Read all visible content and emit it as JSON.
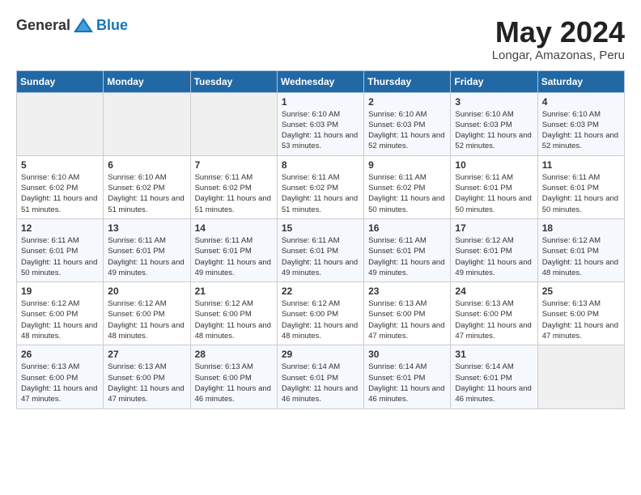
{
  "header": {
    "logo_general": "General",
    "logo_blue": "Blue",
    "month": "May 2024",
    "location": "Longar, Amazonas, Peru"
  },
  "weekdays": [
    "Sunday",
    "Monday",
    "Tuesday",
    "Wednesday",
    "Thursday",
    "Friday",
    "Saturday"
  ],
  "weeks": [
    [
      {
        "day": "",
        "sunrise": "",
        "sunset": "",
        "daylight": ""
      },
      {
        "day": "",
        "sunrise": "",
        "sunset": "",
        "daylight": ""
      },
      {
        "day": "",
        "sunrise": "",
        "sunset": "",
        "daylight": ""
      },
      {
        "day": "1",
        "sunrise": "Sunrise: 6:10 AM",
        "sunset": "Sunset: 6:03 PM",
        "daylight": "Daylight: 11 hours and 53 minutes."
      },
      {
        "day": "2",
        "sunrise": "Sunrise: 6:10 AM",
        "sunset": "Sunset: 6:03 PM",
        "daylight": "Daylight: 11 hours and 52 minutes."
      },
      {
        "day": "3",
        "sunrise": "Sunrise: 6:10 AM",
        "sunset": "Sunset: 6:03 PM",
        "daylight": "Daylight: 11 hours and 52 minutes."
      },
      {
        "day": "4",
        "sunrise": "Sunrise: 6:10 AM",
        "sunset": "Sunset: 6:03 PM",
        "daylight": "Daylight: 11 hours and 52 minutes."
      }
    ],
    [
      {
        "day": "5",
        "sunrise": "Sunrise: 6:10 AM",
        "sunset": "Sunset: 6:02 PM",
        "daylight": "Daylight: 11 hours and 51 minutes."
      },
      {
        "day": "6",
        "sunrise": "Sunrise: 6:10 AM",
        "sunset": "Sunset: 6:02 PM",
        "daylight": "Daylight: 11 hours and 51 minutes."
      },
      {
        "day": "7",
        "sunrise": "Sunrise: 6:11 AM",
        "sunset": "Sunset: 6:02 PM",
        "daylight": "Daylight: 11 hours and 51 minutes."
      },
      {
        "day": "8",
        "sunrise": "Sunrise: 6:11 AM",
        "sunset": "Sunset: 6:02 PM",
        "daylight": "Daylight: 11 hours and 51 minutes."
      },
      {
        "day": "9",
        "sunrise": "Sunrise: 6:11 AM",
        "sunset": "Sunset: 6:02 PM",
        "daylight": "Daylight: 11 hours and 50 minutes."
      },
      {
        "day": "10",
        "sunrise": "Sunrise: 6:11 AM",
        "sunset": "Sunset: 6:01 PM",
        "daylight": "Daylight: 11 hours and 50 minutes."
      },
      {
        "day": "11",
        "sunrise": "Sunrise: 6:11 AM",
        "sunset": "Sunset: 6:01 PM",
        "daylight": "Daylight: 11 hours and 50 minutes."
      }
    ],
    [
      {
        "day": "12",
        "sunrise": "Sunrise: 6:11 AM",
        "sunset": "Sunset: 6:01 PM",
        "daylight": "Daylight: 11 hours and 50 minutes."
      },
      {
        "day": "13",
        "sunrise": "Sunrise: 6:11 AM",
        "sunset": "Sunset: 6:01 PM",
        "daylight": "Daylight: 11 hours and 49 minutes."
      },
      {
        "day": "14",
        "sunrise": "Sunrise: 6:11 AM",
        "sunset": "Sunset: 6:01 PM",
        "daylight": "Daylight: 11 hours and 49 minutes."
      },
      {
        "day": "15",
        "sunrise": "Sunrise: 6:11 AM",
        "sunset": "Sunset: 6:01 PM",
        "daylight": "Daylight: 11 hours and 49 minutes."
      },
      {
        "day": "16",
        "sunrise": "Sunrise: 6:11 AM",
        "sunset": "Sunset: 6:01 PM",
        "daylight": "Daylight: 11 hours and 49 minutes."
      },
      {
        "day": "17",
        "sunrise": "Sunrise: 6:12 AM",
        "sunset": "Sunset: 6:01 PM",
        "daylight": "Daylight: 11 hours and 49 minutes."
      },
      {
        "day": "18",
        "sunrise": "Sunrise: 6:12 AM",
        "sunset": "Sunset: 6:01 PM",
        "daylight": "Daylight: 11 hours and 48 minutes."
      }
    ],
    [
      {
        "day": "19",
        "sunrise": "Sunrise: 6:12 AM",
        "sunset": "Sunset: 6:00 PM",
        "daylight": "Daylight: 11 hours and 48 minutes."
      },
      {
        "day": "20",
        "sunrise": "Sunrise: 6:12 AM",
        "sunset": "Sunset: 6:00 PM",
        "daylight": "Daylight: 11 hours and 48 minutes."
      },
      {
        "day": "21",
        "sunrise": "Sunrise: 6:12 AM",
        "sunset": "Sunset: 6:00 PM",
        "daylight": "Daylight: 11 hours and 48 minutes."
      },
      {
        "day": "22",
        "sunrise": "Sunrise: 6:12 AM",
        "sunset": "Sunset: 6:00 PM",
        "daylight": "Daylight: 11 hours and 48 minutes."
      },
      {
        "day": "23",
        "sunrise": "Sunrise: 6:13 AM",
        "sunset": "Sunset: 6:00 PM",
        "daylight": "Daylight: 11 hours and 47 minutes."
      },
      {
        "day": "24",
        "sunrise": "Sunrise: 6:13 AM",
        "sunset": "Sunset: 6:00 PM",
        "daylight": "Daylight: 11 hours and 47 minutes."
      },
      {
        "day": "25",
        "sunrise": "Sunrise: 6:13 AM",
        "sunset": "Sunset: 6:00 PM",
        "daylight": "Daylight: 11 hours and 47 minutes."
      }
    ],
    [
      {
        "day": "26",
        "sunrise": "Sunrise: 6:13 AM",
        "sunset": "Sunset: 6:00 PM",
        "daylight": "Daylight: 11 hours and 47 minutes."
      },
      {
        "day": "27",
        "sunrise": "Sunrise: 6:13 AM",
        "sunset": "Sunset: 6:00 PM",
        "daylight": "Daylight: 11 hours and 47 minutes."
      },
      {
        "day": "28",
        "sunrise": "Sunrise: 6:13 AM",
        "sunset": "Sunset: 6:00 PM",
        "daylight": "Daylight: 11 hours and 46 minutes."
      },
      {
        "day": "29",
        "sunrise": "Sunrise: 6:14 AM",
        "sunset": "Sunset: 6:01 PM",
        "daylight": "Daylight: 11 hours and 46 minutes."
      },
      {
        "day": "30",
        "sunrise": "Sunrise: 6:14 AM",
        "sunset": "Sunset: 6:01 PM",
        "daylight": "Daylight: 11 hours and 46 minutes."
      },
      {
        "day": "31",
        "sunrise": "Sunrise: 6:14 AM",
        "sunset": "Sunset: 6:01 PM",
        "daylight": "Daylight: 11 hours and 46 minutes."
      },
      {
        "day": "",
        "sunrise": "",
        "sunset": "",
        "daylight": ""
      }
    ]
  ]
}
